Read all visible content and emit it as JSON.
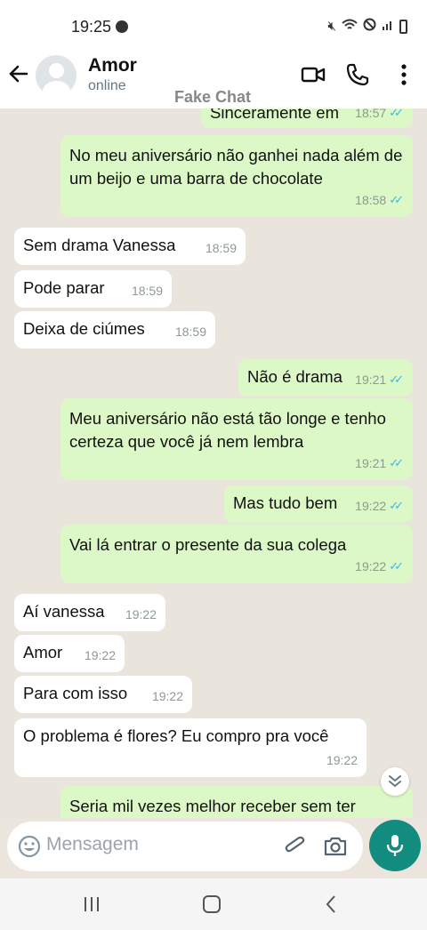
{
  "status_bar": {
    "time": "19:25"
  },
  "header": {
    "contact_name": "Amor",
    "contact_status": "online"
  },
  "watermark": "Fake Chat",
  "messages": [
    {
      "dir": "out",
      "text": "Sinceramente em",
      "time": "18:57",
      "ticks": true
    },
    {
      "dir": "out",
      "text": "No meu aniversário não ganhei nada além de um beijo e uma barra de chocolate",
      "time": "18:58",
      "ticks": true
    },
    {
      "dir": "in",
      "text": "Sem drama Vanessa",
      "time": "18:59"
    },
    {
      "dir": "in",
      "text": "Pode parar",
      "time": "18:59"
    },
    {
      "dir": "in",
      "text": "Deixa de ciúmes",
      "time": "18:59"
    },
    {
      "dir": "out",
      "text": "Não é drama",
      "time": "19:21",
      "ticks": true
    },
    {
      "dir": "out",
      "text": "Meu aniversário não está tão longe e tenho certeza que você já nem lembra",
      "time": "19:21",
      "ticks": true
    },
    {
      "dir": "out",
      "text": "Mas tudo bem",
      "time": "19:22",
      "ticks": true
    },
    {
      "dir": "out",
      "text": "Vai lá entrar o presente da sua colega",
      "time": "19:22",
      "ticks": true
    },
    {
      "dir": "in",
      "text": "Aí vanessa",
      "time": "19:22"
    },
    {
      "dir": "in",
      "text": "Amor",
      "time": "19:22"
    },
    {
      "dir": "in",
      "text": "Para com isso",
      "time": "19:22"
    },
    {
      "dir": "in",
      "text": "O problema é flores? Eu compro pra você",
      "time": "19:22"
    },
    {
      "dir": "out",
      "text": "Seria mil vezes melhor receber sem ter",
      "time": "",
      "ticks": false
    }
  ],
  "composer": {
    "placeholder": "Mensagem"
  },
  "icons": {
    "back": "arrow-left-icon",
    "video": "video-call-icon",
    "call": "phone-icon",
    "more": "more-vertical-icon",
    "emoji": "emoji-icon",
    "attach": "paperclip-icon",
    "camera": "camera-icon",
    "mic": "mic-icon",
    "scroll": "chevrons-down-icon"
  },
  "colors": {
    "outgoing_bubble": "#dcf8c6",
    "incoming_bubble": "#ffffff",
    "accent": "#128c7e",
    "read_ticks": "#34b7f1"
  }
}
